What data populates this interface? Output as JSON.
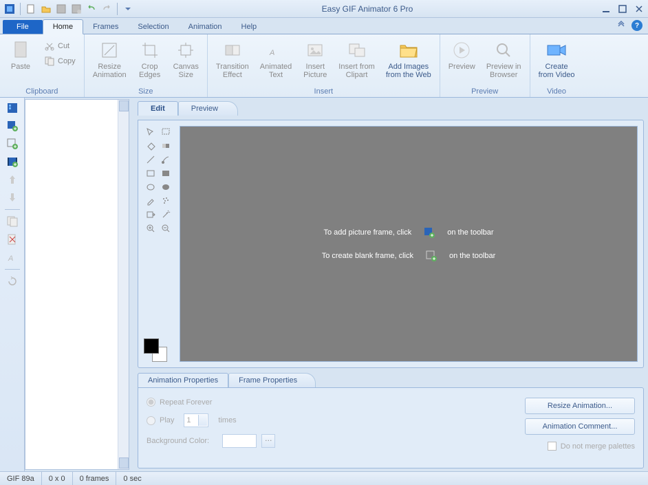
{
  "title": "Easy GIF Animator 6 Pro",
  "qat": [
    {
      "name": "app-icon"
    },
    {
      "name": "new-icon"
    },
    {
      "name": "open-icon"
    },
    {
      "name": "save-icon"
    },
    {
      "name": "save-as-icon"
    },
    {
      "name": "undo-icon"
    },
    {
      "name": "redo-icon"
    }
  ],
  "tabs": {
    "file": "File",
    "home": "Home",
    "frames": "Frames",
    "selection": "Selection",
    "animation": "Animation",
    "help": "Help"
  },
  "ribbon": {
    "clipboard": {
      "label": "Clipboard",
      "paste": "Paste",
      "cut": "Cut",
      "copy": "Copy"
    },
    "size": {
      "label": "Size",
      "resize": "Resize\nAnimation",
      "crop": "Crop\nEdges",
      "canvas": "Canvas\nSize"
    },
    "insert": {
      "label": "Insert",
      "transition": "Transition\nEffect",
      "animtext": "Animated\nText",
      "picture": "Insert\nPicture",
      "clipart": "Insert from\nClipart",
      "web": "Add Images\nfrom the Web"
    },
    "preview": {
      "label": "Preview",
      "preview": "Preview",
      "browser": "Preview in\nBrowser"
    },
    "video": {
      "label": "Video",
      "create": "Create\nfrom Video"
    }
  },
  "editTabs": {
    "edit": "Edit",
    "preview": "Preview"
  },
  "canvasHints": {
    "picture": {
      "pre": "To add picture frame, click",
      "post": "on the toolbar"
    },
    "blank": {
      "pre": "To create blank frame, click",
      "post": "on the toolbar"
    }
  },
  "propsTabs": {
    "anim": "Animation Properties",
    "frame": "Frame Properties"
  },
  "props": {
    "repeat": "Repeat Forever",
    "play": "Play",
    "playCount": "1",
    "times": "times",
    "bgcolor": "Background Color:",
    "resize": "Resize Animation...",
    "comment": "Animation Comment...",
    "merge": "Do not merge palettes"
  },
  "status": {
    "format": "GIF 89a",
    "dim": "0 x 0",
    "frames": "0 frames",
    "time": "0 sec"
  }
}
